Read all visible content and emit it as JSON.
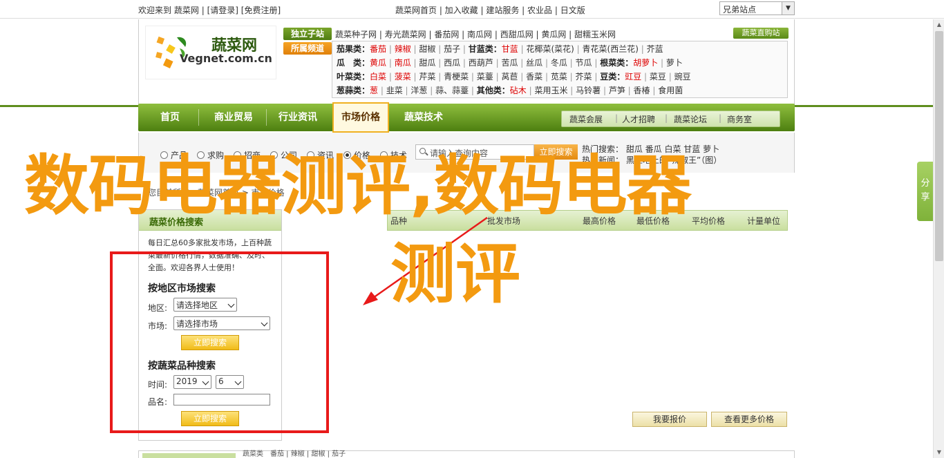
{
  "topbar": {
    "welcome": "欢迎来到",
    "site": "蔬菜网",
    "login": "[请登录]",
    "register": "[免费注册]",
    "links": "蔬菜网首页 | 加入收藏 | 建站服务 | 农业品 | 日文版",
    "select_value": "兄弟站点"
  },
  "logo": {
    "cn": "蔬菜网",
    "en": "Vegnet.com.cn"
  },
  "tags": {
    "t1": "独立子站",
    "t2": "所属频道"
  },
  "seed_row": "蔬菜种子网 | 寿光蔬菜网 | 番茄网 | 南瓜网 | 西甜瓜网 | 黄瓜网 | 甜糯玉米网",
  "zhiban": "蔬菜直购站",
  "categories": [
    {
      "label": "茄果类：",
      "items": [
        "番茄",
        "辣椒",
        "甜椒",
        "茄子"
      ],
      "label2": "甘蓝类：",
      "items2": [
        "甘蓝",
        "花椰菜(菜花)",
        "青花菜(西兰花)",
        "芥蓝"
      ]
    },
    {
      "label": "瓜　类：",
      "items": [
        "黄瓜",
        "南瓜",
        "甜瓜",
        "西瓜",
        "西葫芦",
        "苦瓜",
        "丝瓜",
        "冬瓜",
        "节瓜"
      ],
      "label2": "根菜类：",
      "items2": [
        "胡萝卜",
        "萝卜"
      ]
    },
    {
      "label": "叶菜类：",
      "items": [
        "白菜",
        "菠菜",
        "芹菜",
        "青梗菜",
        "菜薹",
        "莴苣",
        "香菜",
        "苋菜",
        "芥菜"
      ],
      "label2": "豆类：",
      "items2": [
        "豇豆",
        "菜豆",
        "豌豆"
      ]
    },
    {
      "label": "葱蒜类：",
      "items": [
        "葱",
        "韭菜",
        "洋葱",
        "蒜、蒜薹"
      ],
      "label2": "其他类：",
      "items2": [
        "砧木",
        "菜用玉米",
        "马铃薯",
        "芦笋",
        "香椿",
        "食用菌"
      ]
    }
  ],
  "nav": {
    "items": [
      "首页",
      "商业贸易",
      "行业资讯",
      "市场价格",
      "蔬菜技术"
    ],
    "sub": [
      "蔬菜会展",
      "人才招聘",
      "蔬菜论坛",
      "商务室"
    ]
  },
  "search": {
    "radios": [
      "产品",
      "求购",
      "招商",
      "公司",
      "资讯",
      "价格",
      "技术"
    ],
    "selected": "价格",
    "placeholder": "请输入查询内容",
    "button": "立即搜索",
    "hot_label": "热门搜索：",
    "hot": "甜瓜 番瓜 白菜 甘蓝 萝卜",
    "news_label": "热门新闻：",
    "news": "黑土地上的“辣椒王”（图）"
  },
  "breadcrumb": "您目前所在：蔬菜网首页 > 市场价格",
  "left_panel": {
    "title": "蔬菜价格搜索",
    "desc": "每日汇总60多家批发市场，上百种蔬菜最新价格行情，数据准确、及时、全面。欢迎各界人士使用！",
    "sec1": "按地区市场搜索",
    "area_label": "地区:",
    "area_value": "请选择地区",
    "market_label": "市场:",
    "market_value": "请选择市场",
    "btn1": "立即搜索",
    "sec2": "按蔬菜品种搜索",
    "time_label": "时间:",
    "year": "2019",
    "month": "6",
    "name_label": "品名:",
    "btn2": "立即搜索"
  },
  "table": {
    "cols": [
      "品种",
      "批发市场",
      "最高价格",
      "最低价格",
      "平均价格",
      "计量单位"
    ],
    "btn_report": "我要报价",
    "btn_more": "查看更多价格"
  },
  "bottom": {
    "text": "蔬菜类　番茄 | 辣椒 | 甜椒 | 茄子"
  },
  "share": "分享",
  "overlay": {
    "line1": "数码电器测评,数码电器",
    "line2": "测评"
  },
  "colors": {
    "brand_green": "#5e8d1e",
    "accent_orange": "#f39a10",
    "red": "#e81a1a"
  }
}
